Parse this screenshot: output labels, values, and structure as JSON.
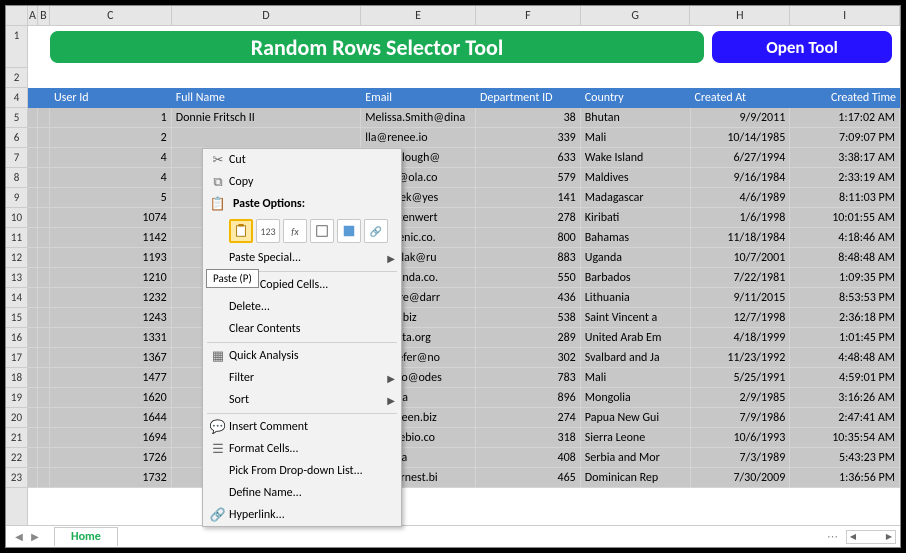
{
  "banner": {
    "title": "Random Rows Selector Tool",
    "button": "Open Tool"
  },
  "columns": [
    "A",
    "B",
    "C",
    "D",
    "E",
    "F",
    "G",
    "H",
    "I"
  ],
  "row_numbers": [
    1,
    2,
    4,
    5,
    6,
    7,
    8,
    9,
    10,
    11,
    12,
    13,
    14,
    15,
    16,
    17,
    18,
    19,
    20,
    21,
    22,
    23
  ],
  "headers": {
    "c": "User Id",
    "d": "Full Name",
    "e": "Email",
    "f": "Department ID",
    "g": "Country",
    "h": "Created At",
    "i": "Created Time"
  },
  "rows": [
    {
      "uid": "1",
      "name": "Donnie Fritsch II",
      "email": "Melissa.Smith@dina",
      "dept": "38",
      "country": "Bhutan",
      "date": "9/9/2011",
      "time": "1:17:02 AM"
    },
    {
      "uid": "2",
      "name": "",
      "email": "lla@renee.io",
      "dept": "339",
      "country": "Mali",
      "date": "10/14/1985",
      "time": "7:09:07 PM"
    },
    {
      "uid": "4",
      "name": "",
      "email": "_McCullough@",
      "dept": "633",
      "country": "Wake Island",
      "date": "6/27/1994",
      "time": "3:38:17 AM"
    },
    {
      "uid": "4",
      "name": "",
      "email": "_Ebert@ola.co",
      "dept": "579",
      "country": "Maldives",
      "date": "9/16/1984",
      "time": "2:33:19 AM"
    },
    {
      "uid": "5",
      "name": "",
      "email": "a_Paucek@yes",
      "dept": "141",
      "country": "Madagascar",
      "date": "4/6/1989",
      "time": "8:11:03 PM"
    },
    {
      "uid": "1074",
      "name": "",
      "email": "nny_Altenwert",
      "dept": "278",
      "country": "Kiribati",
      "date": "1/6/1998",
      "time": "10:01:55 AM"
    },
    {
      "uid": "1142",
      "name": "",
      "email": "@domenic.co.",
      "dept": "800",
      "country": "Bahamas",
      "date": "11/18/1984",
      "time": "4:18:46 AM"
    },
    {
      "uid": "1193",
      "name": "",
      "email": "an.Zemlak@ru",
      "dept": "883",
      "country": "Uganda",
      "date": "10/7/2001",
      "time": "8:48:48 AM"
    },
    {
      "uid": "1210",
      "name": "",
      "email": "d@yolanda.co.",
      "dept": "550",
      "country": "Barbados",
      "date": "7/22/1981",
      "time": "1:09:35 PM"
    },
    {
      "uid": "1232",
      "name": "",
      "email": "s_Moore@darr",
      "dept": "436",
      "country": "Lithuania",
      "date": "9/11/2015",
      "time": "8:53:53 PM"
    },
    {
      "uid": "1243",
      "name": "",
      "email": "Dkelley.biz",
      "dept": "538",
      "country": "Saint Vincent a",
      "date": "12/7/1998",
      "time": "2:36:18 PM"
    },
    {
      "uid": "1331",
      "name": "",
      "email": "tto@fleta.org",
      "dept": "289",
      "country": "United Arab Em",
      "date": "4/18/1999",
      "time": "1:01:45 PM"
    },
    {
      "uid": "1367",
      "name": "",
      "email": "n.Schaefer@no",
      "dept": "302",
      "country": "Svalbard and Ja",
      "date": "11/23/1992",
      "time": "4:48:48 AM"
    },
    {
      "uid": "1477",
      "name": "",
      "email": "_Maggio@odes",
      "dept": "783",
      "country": "Mali",
      "date": "5/25/1991",
      "time": "4:59:01 PM"
    },
    {
      "uid": "1620",
      "name": "",
      "email": "@isac.ca",
      "dept": "896",
      "country": "Mongolia",
      "date": "2/9/1985",
      "time": "3:16:26 AM"
    },
    {
      "uid": "1644",
      "name": "",
      "email": "@maureen.biz",
      "dept": "274",
      "country": "Papua New Gui",
      "date": "7/9/1986",
      "time": "2:47:41 AM"
    },
    {
      "uid": "1694",
      "name": "",
      "email": "n@eusebio.co",
      "dept": "318",
      "country": "Sierra Leone",
      "date": "10/6/1993",
      "time": "10:35:54 AM"
    },
    {
      "uid": "1726",
      "name": "",
      "email": "@lina.ca",
      "dept": "408",
      "country": "Serbia and Mor",
      "date": "7/3/1989",
      "time": "5:43:23 PM"
    },
    {
      "uid": "1732",
      "name": "",
      "email": "que@ernest.bi",
      "dept": "465",
      "country": "Dominican Rep",
      "date": "7/30/2009",
      "time": "1:36:56 PM"
    }
  ],
  "context_menu": {
    "cut": "Cut",
    "copy": "Copy",
    "paste_options": "Paste Options:",
    "paste_special": "Paste Special...",
    "insert_copied": "Insert Copied Cells...",
    "delete": "Delete...",
    "clear_contents": "Clear Contents",
    "quick_analysis": "Quick Analysis",
    "filter": "Filter",
    "sort": "Sort",
    "insert_comment": "Insert Comment",
    "format_cells": "Format Cells...",
    "pick_list": "Pick From Drop-down List...",
    "define_name": "Define Name...",
    "hyperlink": "Hyperlink..."
  },
  "tooltip": "Paste (P)",
  "sheet_tab": "Home"
}
